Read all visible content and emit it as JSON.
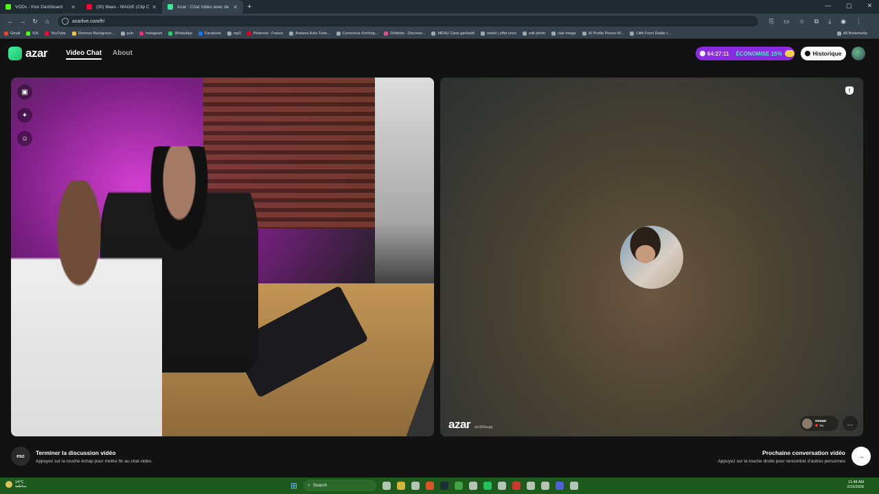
{
  "browser": {
    "tabs": [
      {
        "title": "VODs - Kick Dashboard",
        "color": "#53fc18",
        "active": false
      },
      {
        "title": "(30) Maes - MAGIE (Clip Officiel)",
        "color": "#ff0033",
        "active": false
      },
      {
        "title": "Azar : Chat Vidéo avec de",
        "color": "#3de89a",
        "active": true
      }
    ],
    "url": "azarlive.com/fr/",
    "bookmarks": [
      "Gmail",
      "KIK",
      "YouTube",
      "Remove Backgroun...",
      "pub",
      "Instagram",
      "WhatsApp",
      "Facebook",
      "mp3",
      "Pinterest - France",
      "Antares Auto-Tune...",
      "Correcteur d'orthog...",
      "Dribbble - Discover...",
      "MENU Carte garibaldi",
      "mixkit ( effet sono",
      "edit photo",
      "clair image",
      "AI Profile Picture M...",
      "Lilith From Diablo I..."
    ],
    "all_bookmarks": "All Bookmarks"
  },
  "header": {
    "logo": "azar",
    "nav_video_chat": "Video Chat",
    "nav_about": "About",
    "timer": "64:27:11",
    "save_label": "ÉCONOMISE 15%",
    "history_label": "Historique"
  },
  "remote": {
    "watermark": "azar",
    "session_id": "a3-683scgq",
    "username": "omaar",
    "country": "TN"
  },
  "footer": {
    "esc_key": "esc",
    "end_title": "Terminer la discussion vidéo",
    "end_sub": "Appuyez sur la touche échap pour mettre fin au chat vidéo.",
    "next_title": "Prochaine conversation vidéo",
    "next_sub": "Appuyez sur la touche droite pour rencontrer d'autres personnes"
  },
  "taskbar": {
    "temp": "14°C",
    "weather_text": "ساطعة",
    "search": "Search",
    "time": "11:48 AM",
    "date": "2/15/2026"
  }
}
